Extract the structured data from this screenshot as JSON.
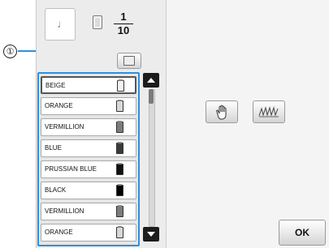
{
  "callout": {
    "label": "①",
    "color": "#2f8fdc"
  },
  "counter": {
    "numerator": "1",
    "denominator": "10"
  },
  "colors": [
    {
      "name": "BEIGE",
      "swatch": "#f2f2f2",
      "selected": true
    },
    {
      "name": "ORANGE",
      "swatch": "#d8d8d8",
      "selected": false
    },
    {
      "name": "VERMILLION",
      "swatch": "#7c7c7c",
      "selected": false
    },
    {
      "name": "BLUE",
      "swatch": "#3a3a3a",
      "selected": false
    },
    {
      "name": "PRUSSIAN BLUE",
      "swatch": "#111111",
      "selected": false
    },
    {
      "name": "BLACK",
      "swatch": "#000000",
      "selected": false
    },
    {
      "name": "VERMILLION",
      "swatch": "#7c7c7c",
      "selected": false
    },
    {
      "name": "ORANGE",
      "swatch": "#d8d8d8",
      "selected": false
    }
  ],
  "icons": {
    "preview": "needle-thread-icon",
    "spool": "thread-spool-icon",
    "small_button": "spool-sort-icon",
    "hand": "hand-icon",
    "stitch": "stitch-pattern-icon",
    "scroll_up": "arrow-up-icon",
    "scroll_down": "arrow-down-icon"
  },
  "buttons": {
    "ok": "OK"
  }
}
